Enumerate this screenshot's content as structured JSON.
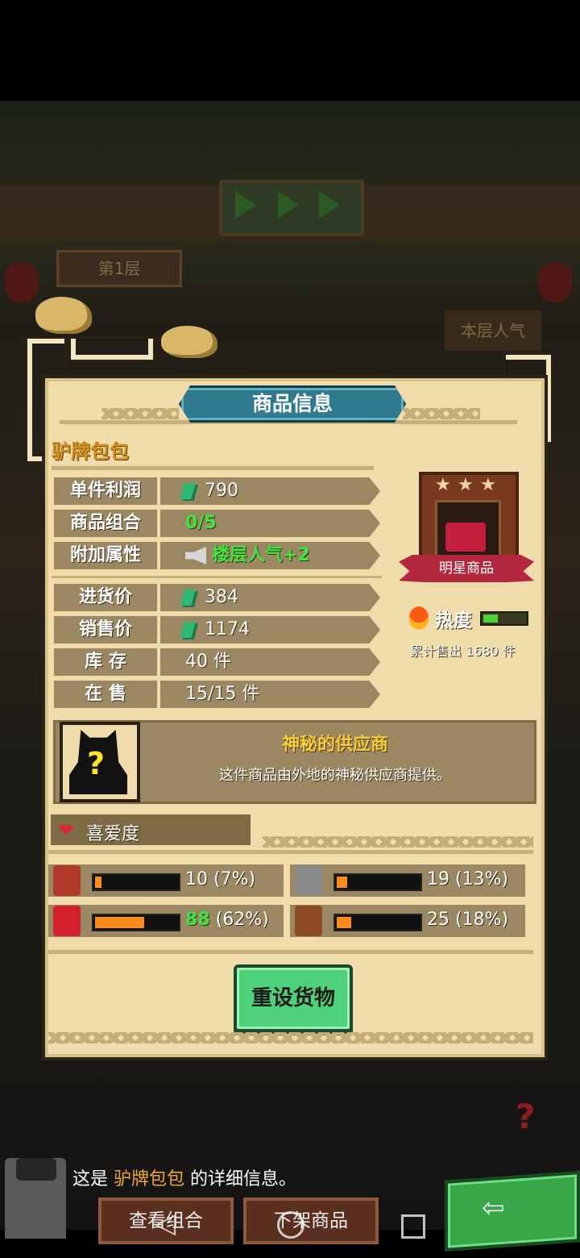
{
  "background": {
    "floor_label": "第1层",
    "floor_popularity": "本层人气"
  },
  "panel": {
    "title": "商品信息",
    "item_name": "驴牌包包",
    "stats": [
      {
        "label": "单件利润",
        "value": "790",
        "money": true,
        "highlight": false
      },
      {
        "label": "商品组合",
        "value": "0/5",
        "money": false,
        "highlight": true
      },
      {
        "label": "附加属性",
        "value": "楼层人气+2",
        "money": false,
        "highlight": true,
        "icon": "megaphone-icon"
      },
      {
        "label": "进货价",
        "value": "384",
        "money": true,
        "highlight": false
      },
      {
        "label": "销售价",
        "value": "1174",
        "money": true,
        "highlight": false
      },
      {
        "label": "库 存",
        "value": "40 件",
        "money": false,
        "highlight": false
      },
      {
        "label": "在 售",
        "value": "15/15 件",
        "money": false,
        "highlight": false
      }
    ],
    "star_item": {
      "stars": 3,
      "badge": "明星商品",
      "icon": "handbag-icon"
    },
    "heat": {
      "label": "热度",
      "level": 0.35,
      "sold_text": "累计售出 1680 件"
    },
    "supplier": {
      "name": "神秘的供应商",
      "description": "这件商品由外地的神秘供应商提供。",
      "portrait_mark": "?"
    },
    "affection": {
      "title": "喜爱度",
      "customers": [
        {
          "value": "10",
          "percent_text": "(7%)",
          "fraction": 0.07,
          "highlight": false,
          "avatar_color": "#b23a2a"
        },
        {
          "value": "19",
          "percent_text": "(13%)",
          "fraction": 0.13,
          "highlight": false,
          "avatar_color": "#8a8a8a"
        },
        {
          "value": "88",
          "percent_text": "(62%)",
          "fraction": 0.62,
          "highlight": true,
          "avatar_color": "#d2202e"
        },
        {
          "value": "25",
          "percent_text": "(18%)",
          "fraction": 0.18,
          "highlight": false,
          "avatar_color": "#8b4a22"
        }
      ]
    },
    "reset_button": "重设货物"
  },
  "dialog": {
    "prefix": "这是",
    "item": "驴牌包包",
    "suffix": "的详细信息。"
  },
  "bottom": {
    "view_combo": "查看组合",
    "remove": "下架商品"
  },
  "colors": {
    "panel_bg": "#efdcaa",
    "label_bg": "#9b8762",
    "accent_teal": "#2f7a8e",
    "highlight_green": "#3ee63f",
    "item_name_gold": "#d3911c",
    "bar_orange": "#ff8c1a",
    "button_green": "#4fd07b"
  }
}
